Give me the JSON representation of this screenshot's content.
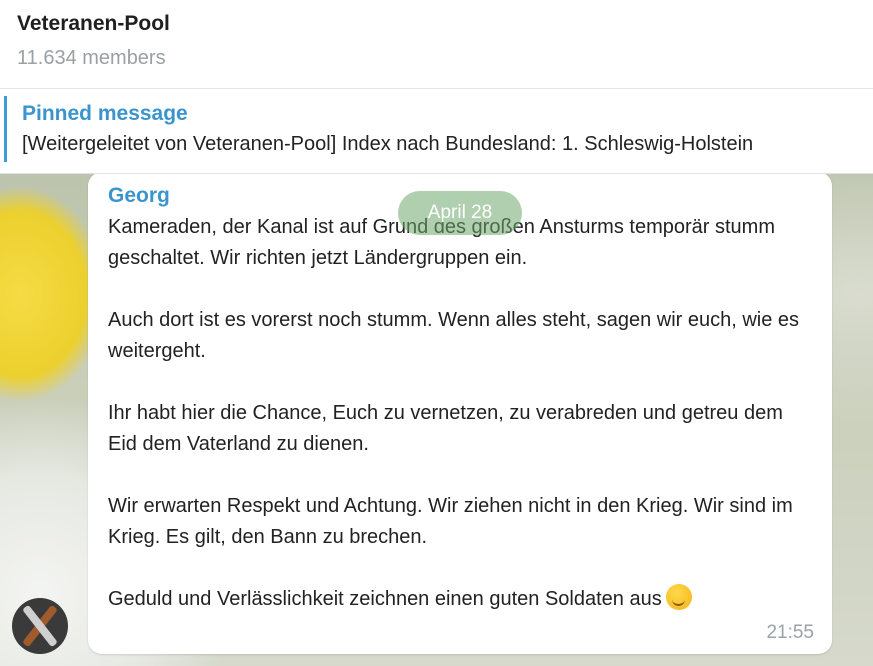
{
  "header": {
    "title": "Veteranen-Pool",
    "member_count": "11.634 members"
  },
  "pinned": {
    "title": "Pinned message",
    "text": "[Weitergeleitet von Veteranen-Pool] Index nach Bundesland: 1. Schleswig-Holstein"
  },
  "chat": {
    "date_label": "April 28",
    "message": {
      "sender": "Georg",
      "paragraphs": [
        "Kameraden, der Kanal ist auf Grund des großen Ansturms temporär stumm geschaltet. Wir richten jetzt Ländergruppen ein.",
        "Auch dort ist es vorerst noch stumm. Wenn alles steht, sagen wir euch, wie es weitergeht.",
        "Ihr habt hier die Chance, Euch zu vernetzen, zu verabreden und getreu dem Eid dem Vaterland zu dienen.",
        "Wir erwarten Respekt und Achtung. Wir ziehen nicht in den Krieg. Wir sind im Krieg. Es gilt, den Bann zu brechen.",
        "Geduld und Verlässlichkeit zeichnen einen guten Soldaten aus"
      ],
      "emoji": "winking-face-emoji",
      "time": "21:55"
    }
  },
  "colors": {
    "accent": "#3a95cf",
    "date_pill": "#6ea86e"
  }
}
